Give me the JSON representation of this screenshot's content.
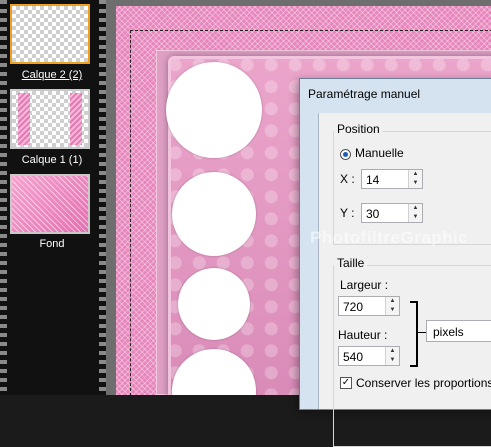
{
  "layers_panel": {
    "items": [
      {
        "label": "Calque 2 (2)",
        "selected": true
      },
      {
        "label": "Calque 1 (1)",
        "selected": false
      },
      {
        "label": "Fond",
        "selected": false
      }
    ]
  },
  "canvas": {
    "watermark": "PhotofiltreGraphic"
  },
  "dialog": {
    "title": "Paramétrage manuel",
    "position": {
      "legend": "Position",
      "manual_label": "Manuelle",
      "x_label": "X :",
      "x_value": "14",
      "y_label": "Y :",
      "y_value": "30"
    },
    "size": {
      "legend": "Taille",
      "width_label": "Largeur :",
      "width_value": "720",
      "height_label": "Hauteur :",
      "height_value": "540",
      "unit_value": "pixels",
      "keep_proportions_label": "Conserver les proportions",
      "keep_proportions_checked": true
    }
  },
  "colors": {
    "frame_pink": "#e785bd",
    "selected_layer_border": "#f0a020",
    "dialog_title_bg": "#d5e3f1"
  }
}
